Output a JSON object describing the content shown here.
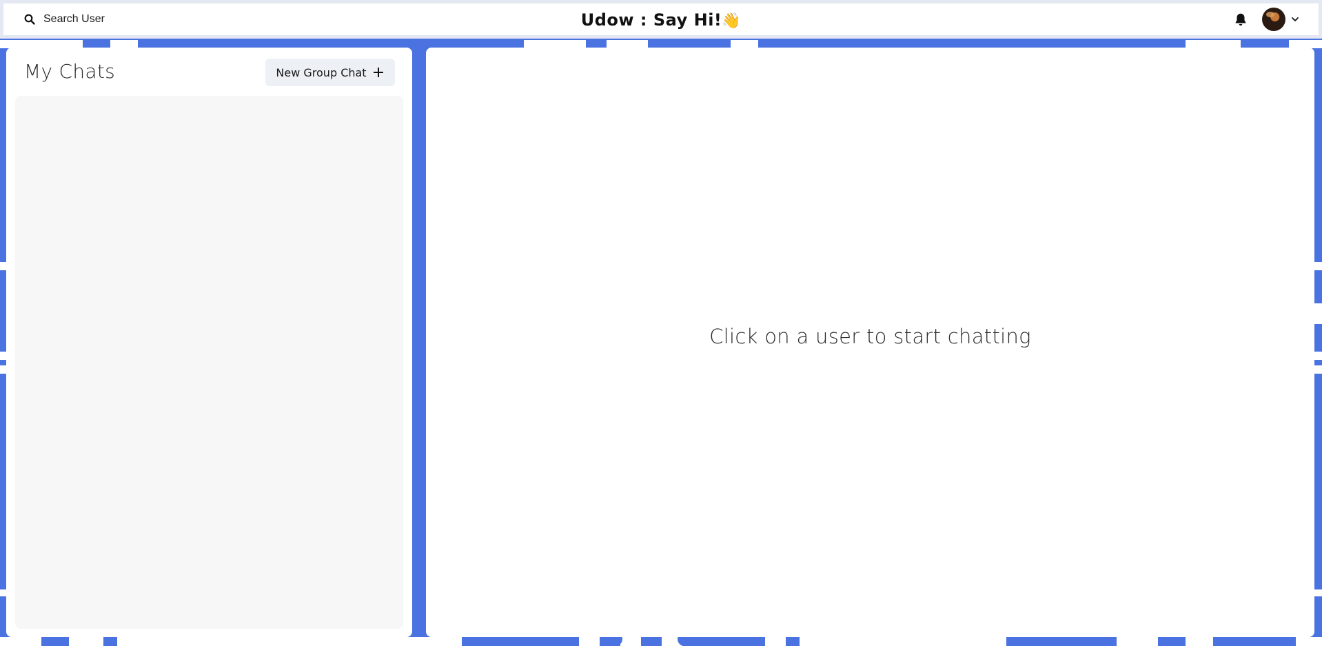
{
  "header": {
    "search_label": "Search User",
    "title": "Udow : Say Hi!",
    "title_emoji": "👋",
    "bell_icon": "bell-icon",
    "avatar_icon": "user-avatar",
    "chevron_icon": "chevron-down-icon"
  },
  "sidebar": {
    "title": "My Chats",
    "new_group_label": "New Group Chat",
    "new_group_icon": "plus-icon",
    "chats": []
  },
  "main": {
    "empty_message": "Click on a user to start chatting"
  },
  "colors": {
    "background": "#4a72e0",
    "panel": "#ffffff",
    "chat_list_bg": "#f7f7f7",
    "button_bg": "#edf1f5"
  }
}
